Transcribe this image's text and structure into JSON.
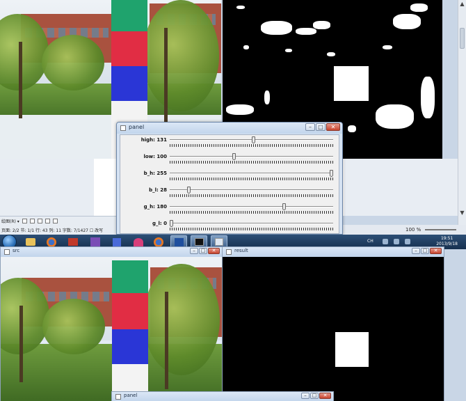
{
  "panel": {
    "title": "panel",
    "trackbars": [
      {
        "label": "high: 131",
        "value": 131,
        "max": 255
      },
      {
        "label": "low: 100",
        "value": 100,
        "max": 255
      },
      {
        "label": "b_h: 255",
        "value": 255,
        "max": 255
      },
      {
        "label": "b_l: 28",
        "value": 28,
        "max": 255
      },
      {
        "label": "g_h: 180",
        "value": 180,
        "max": 255
      },
      {
        "label": "g_l: 0",
        "value": 0,
        "max": 255
      }
    ]
  },
  "windows": {
    "src_title": "src",
    "result_title": "result",
    "panel_bottom_title": "panel"
  },
  "window_buttons": {
    "minimize": "–",
    "maximize": "□",
    "close": "✕"
  },
  "editor_status": {
    "draw_label": "绘图(R) ▾",
    "line": "页面: 2/2  节: 1/1  行: 43  列: 11  字数: 7/1427  ☐ 改写"
  },
  "word_status": {
    "zoom": "100 %"
  },
  "taskbar": {
    "clock_time": "19:51",
    "clock_date": "2013/9/18",
    "lang": "CH"
  },
  "colors": {
    "pole_green": "#1fa36d",
    "pole_red": "#e12d44",
    "pole_blue": "#2a36d6",
    "taskbar": "#1f3d61"
  },
  "icons": [
    "windows-start-icon",
    "folder-icon",
    "firefox-icon",
    "media-player-icon",
    "vs-icon",
    "cube-icon",
    "rss-icon",
    "firefox-icon",
    "word-icon",
    "console-icon",
    "window-icon"
  ]
}
